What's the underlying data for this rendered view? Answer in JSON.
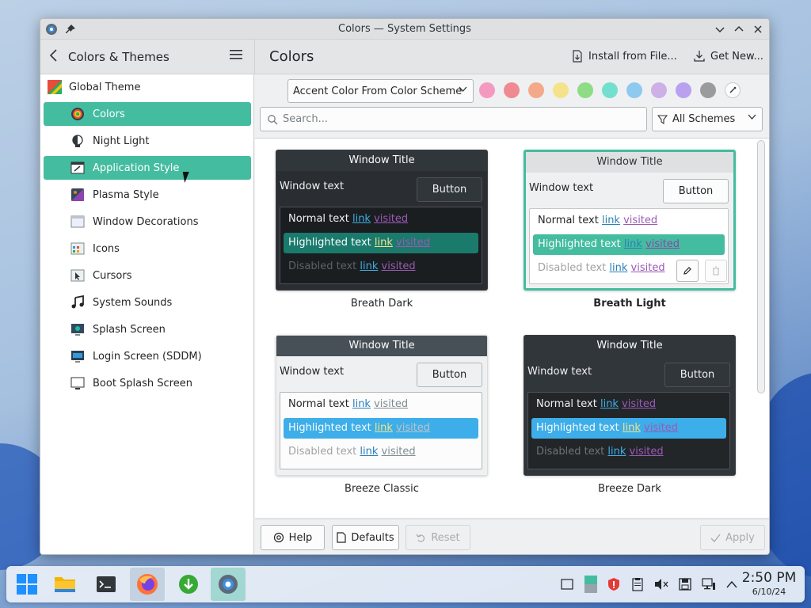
{
  "window": {
    "title": "Colors — System Settings"
  },
  "header": {
    "back_icon": "chevron-left-icon",
    "left_title": "Colors & Themes",
    "page_title": "Colors",
    "install_label": "Install from File...",
    "getnew_label": "Get New..."
  },
  "sidebar": {
    "items": [
      {
        "label": "Global Theme",
        "icon": "global-theme-icon",
        "active": false
      },
      {
        "label": "Colors",
        "icon": "colors-icon",
        "active": true
      },
      {
        "label": "Night Light",
        "icon": "night-light-icon",
        "active": false
      },
      {
        "label": "Application Style",
        "icon": "application-style-icon",
        "active": true
      },
      {
        "label": "Plasma Style",
        "icon": "plasma-style-icon",
        "active": false
      },
      {
        "label": "Window Decorations",
        "icon": "window-decorations-icon",
        "active": false
      },
      {
        "label": "Icons",
        "icon": "icons-icon",
        "active": false
      },
      {
        "label": "Cursors",
        "icon": "cursors-icon",
        "active": false
      },
      {
        "label": "System Sounds",
        "icon": "music-note-icon",
        "active": false
      },
      {
        "label": "Splash Screen",
        "icon": "splash-screen-icon",
        "active": false
      },
      {
        "label": "Login Screen (SDDM)",
        "icon": "login-screen-icon",
        "active": false
      },
      {
        "label": "Boot Splash Screen",
        "icon": "boot-splash-icon",
        "active": false
      }
    ]
  },
  "toolbar": {
    "accent_combo": "Accent Color From Color Scheme",
    "accent_colors": [
      "#f49ac1",
      "#ef8a92",
      "#f4a98b",
      "#f4e38a",
      "#8edc86",
      "#73dfcf",
      "#8ec9ef",
      "#cdb0e6",
      "#b9a1f0",
      "#9b9b9b"
    ],
    "search_placeholder": "Search...",
    "filter_combo": "All Schemes"
  },
  "schemes": [
    {
      "name": "Breath Dark",
      "selected": false,
      "window_title": "Window Title",
      "window_text": "Window text",
      "button": "Button",
      "normal": "Normal text",
      "highlighted": "Highlighted text",
      "disabled": "Disabled text",
      "link": "link",
      "visited": "visited"
    },
    {
      "name": "Breath Light",
      "selected": true,
      "window_title": "Window Title",
      "window_text": "Window text",
      "button": "Button",
      "normal": "Normal text",
      "highlighted": "Highlighted text",
      "disabled": "Disabled text",
      "link": "link",
      "visited": "visited"
    },
    {
      "name": "Breeze Classic",
      "selected": false,
      "window_title": "Window Title",
      "window_text": "Window text",
      "button": "Button",
      "normal": "Normal text",
      "highlighted": "Highlighted text",
      "disabled": "Disabled text",
      "link": "link",
      "visited": "visited"
    },
    {
      "name": "Breeze Dark",
      "selected": false,
      "window_title": "Window Title",
      "window_text": "Window text",
      "button": "Button",
      "normal": "Normal text",
      "highlighted": "Highlighted text",
      "disabled": "Disabled text",
      "link": "link",
      "visited": "visited"
    }
  ],
  "footer": {
    "help": "Help",
    "defaults": "Defaults",
    "reset": "Reset",
    "apply": "Apply"
  },
  "taskbar": {
    "time": "2:50 PM",
    "date": "6/10/24"
  },
  "colors": {
    "accent": "#44bc9f"
  }
}
